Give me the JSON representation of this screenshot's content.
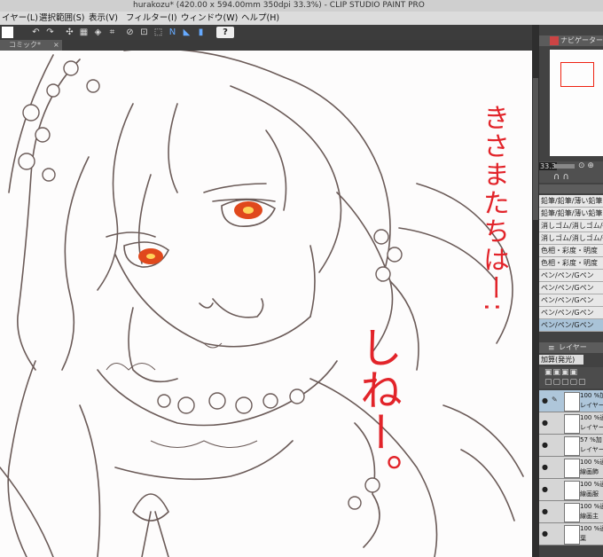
{
  "window": {
    "title": "hurakozu* (420.00 x 594.00mm 350dpi 33.3%) - CLIP STUDIO PAINT PRO"
  },
  "menu": {
    "items": [
      "イヤー(L)",
      "選択範囲(S)",
      "表示(V)",
      "フィルター(I)",
      "ウィンドウ(W)",
      "ヘルプ(H)"
    ]
  },
  "toolbar": {
    "help_label": "?"
  },
  "tabs": {
    "document": "コミック*",
    "close": "×"
  },
  "annotation": {
    "line1": "きさまたちはー:",
    "line2": "しねー。"
  },
  "navigator": {
    "label": "ナビゲーター"
  },
  "brush_size": {
    "value": "33.3"
  },
  "brushes": {
    "items": [
      "鉛筆/鉛筆/薄い鉛筆",
      "鉛筆/鉛筆/薄い鉛筆",
      "消しゴム/消しゴム/硬め",
      "消しゴム/消しゴム/硬め",
      "色相・彩度・明度",
      "色相・彩度・明度",
      "ペン/ペン/Gペン",
      "ペン/ペン/Gペン",
      "ペン/ペン/Gペン",
      "ペン/ペン/Gペン",
      "ペン/ペン/Gペン"
    ],
    "selected_index": 10
  },
  "layers_panel": {
    "label": "レイヤー",
    "blend_mode": "加算(発光)"
  },
  "layers": [
    {
      "line1": "100 %加",
      "line2": "レイヤー",
      "selected": true
    },
    {
      "line1": "100 %通",
      "line2": "レイヤー",
      "selected": false
    },
    {
      "line1": "57 %加",
      "line2": "レイヤー",
      "selected": false
    },
    {
      "line1": "100 %通",
      "line2": "線画飾",
      "selected": false
    },
    {
      "line1": "100 %通",
      "line2": "線画服",
      "selected": false
    },
    {
      "line1": "100 %通",
      "line2": "線画主",
      "selected": false
    },
    {
      "line1": "100 %通",
      "line2": "葉",
      "selected": false
    }
  ],
  "colors": {
    "accent_red": "#e2242a",
    "eye_glow": "#e0481c",
    "panel_dark": "#424242"
  }
}
